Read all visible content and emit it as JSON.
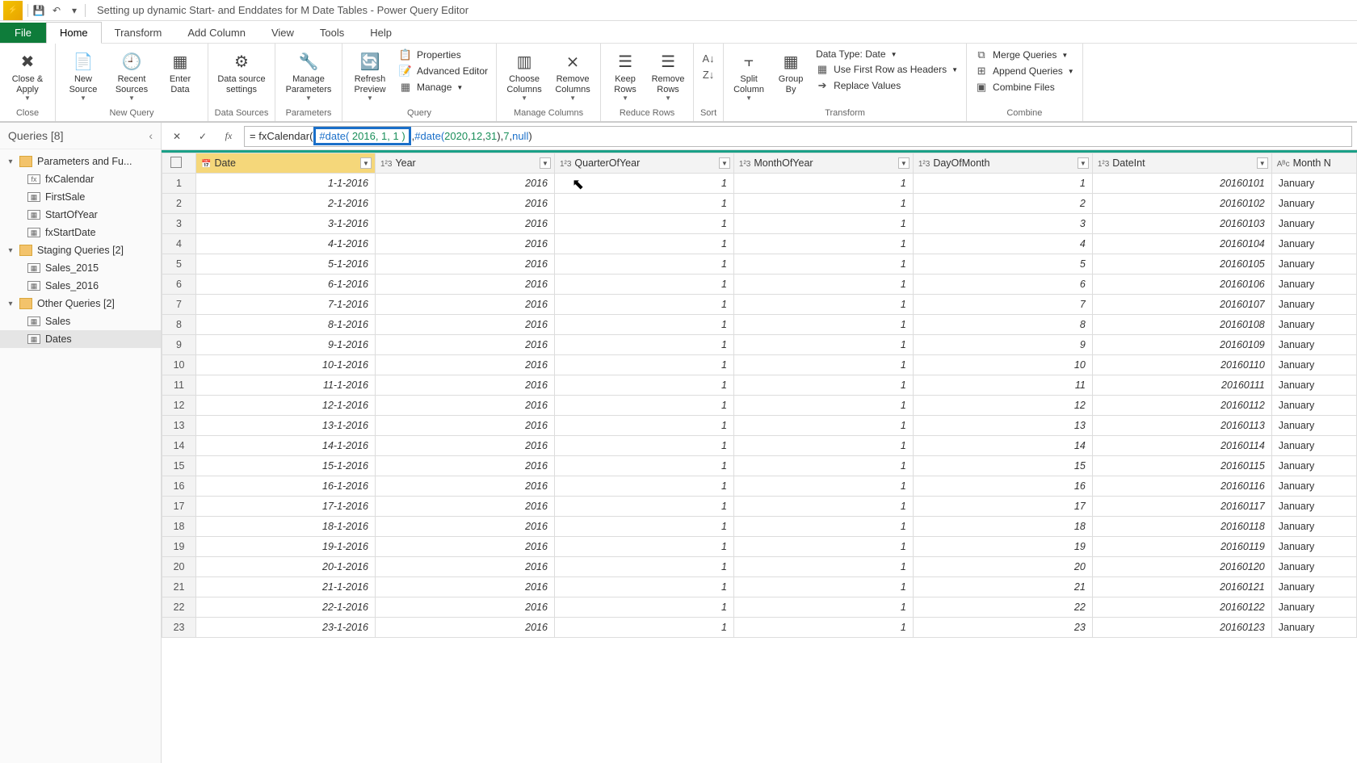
{
  "title": "Setting up dynamic Start- and Enddates for M Date Tables - Power Query Editor",
  "tabs": {
    "file": "File",
    "home": "Home",
    "transform": "Transform",
    "addcol": "Add Column",
    "view": "View",
    "tools": "Tools",
    "help": "Help"
  },
  "ribbon": {
    "close": {
      "close_apply": "Close &\nApply",
      "group": "Close"
    },
    "newquery": {
      "new_source": "New\nSource",
      "recent": "Recent\nSources",
      "enter": "Enter\nData",
      "group": "New Query"
    },
    "datasources": {
      "settings": "Data source\nsettings",
      "group": "Data Sources"
    },
    "parameters": {
      "manage": "Manage\nParameters",
      "group": "Parameters"
    },
    "query": {
      "refresh": "Refresh\nPreview",
      "properties": "Properties",
      "adv": "Advanced Editor",
      "manage": "Manage",
      "group": "Query"
    },
    "managecols": {
      "choose": "Choose\nColumns",
      "remove": "Remove\nColumns",
      "group": "Manage Columns"
    },
    "reducerows": {
      "keep": "Keep\nRows",
      "remove": "Remove\nRows",
      "group": "Reduce Rows"
    },
    "sort": {
      "group": "Sort"
    },
    "transform": {
      "split": "Split\nColumn",
      "groupby": "Group\nBy",
      "datatype": "Data Type: Date",
      "firstrow": "Use First Row as Headers",
      "replace": "Replace Values",
      "group": "Transform"
    },
    "combine": {
      "merge": "Merge Queries",
      "append": "Append Queries",
      "combinefiles": "Combine Files",
      "group": "Combine"
    }
  },
  "queries": {
    "header": "Queries [8]",
    "folder1": "Parameters and Fu...",
    "fxCalendar": "fxCalendar",
    "firstSale": "FirstSale",
    "startOfYear": "StartOfYear",
    "fxStartDate": "fxStartDate",
    "folder2": "Staging Queries [2]",
    "sales2015": "Sales_2015",
    "sales2016": "Sales_2016",
    "folder3": "Other Queries [2]",
    "sales": "Sales",
    "dates": "Dates"
  },
  "formula": {
    "prefix": "= fxCalendar(",
    "hl_kw": "#date(",
    "hl_args": " 2016, 1, 1 )",
    "mid": ", ",
    "kw2": "#date(",
    "args2_a": " 2020",
    "args2_b": ", ",
    "args2_c": "12",
    "args2_d": ", ",
    "args2_e": "31",
    "args2_f": "), ",
    "arg3": "7",
    "sep": ", ",
    "arg4": "null",
    "end": ")"
  },
  "columns": {
    "date": "Date",
    "year": "Year",
    "quarter": "QuarterOfYear",
    "month": "MonthOfYear",
    "day": "DayOfMonth",
    "dateint": "DateInt",
    "monthname": "Month N"
  },
  "rows": [
    {
      "n": 1,
      "date": "1-1-2016",
      "year": 2016,
      "q": 1,
      "m": 1,
      "d": 1,
      "di": 20160101,
      "mn": "January"
    },
    {
      "n": 2,
      "date": "2-1-2016",
      "year": 2016,
      "q": 1,
      "m": 1,
      "d": 2,
      "di": 20160102,
      "mn": "January"
    },
    {
      "n": 3,
      "date": "3-1-2016",
      "year": 2016,
      "q": 1,
      "m": 1,
      "d": 3,
      "di": 20160103,
      "mn": "January"
    },
    {
      "n": 4,
      "date": "4-1-2016",
      "year": 2016,
      "q": 1,
      "m": 1,
      "d": 4,
      "di": 20160104,
      "mn": "January"
    },
    {
      "n": 5,
      "date": "5-1-2016",
      "year": 2016,
      "q": 1,
      "m": 1,
      "d": 5,
      "di": 20160105,
      "mn": "January"
    },
    {
      "n": 6,
      "date": "6-1-2016",
      "year": 2016,
      "q": 1,
      "m": 1,
      "d": 6,
      "di": 20160106,
      "mn": "January"
    },
    {
      "n": 7,
      "date": "7-1-2016",
      "year": 2016,
      "q": 1,
      "m": 1,
      "d": 7,
      "di": 20160107,
      "mn": "January"
    },
    {
      "n": 8,
      "date": "8-1-2016",
      "year": 2016,
      "q": 1,
      "m": 1,
      "d": 8,
      "di": 20160108,
      "mn": "January"
    },
    {
      "n": 9,
      "date": "9-1-2016",
      "year": 2016,
      "q": 1,
      "m": 1,
      "d": 9,
      "di": 20160109,
      "mn": "January"
    },
    {
      "n": 10,
      "date": "10-1-2016",
      "year": 2016,
      "q": 1,
      "m": 1,
      "d": 10,
      "di": 20160110,
      "mn": "January"
    },
    {
      "n": 11,
      "date": "11-1-2016",
      "year": 2016,
      "q": 1,
      "m": 1,
      "d": 11,
      "di": 20160111,
      "mn": "January"
    },
    {
      "n": 12,
      "date": "12-1-2016",
      "year": 2016,
      "q": 1,
      "m": 1,
      "d": 12,
      "di": 20160112,
      "mn": "January"
    },
    {
      "n": 13,
      "date": "13-1-2016",
      "year": 2016,
      "q": 1,
      "m": 1,
      "d": 13,
      "di": 20160113,
      "mn": "January"
    },
    {
      "n": 14,
      "date": "14-1-2016",
      "year": 2016,
      "q": 1,
      "m": 1,
      "d": 14,
      "di": 20160114,
      "mn": "January"
    },
    {
      "n": 15,
      "date": "15-1-2016",
      "year": 2016,
      "q": 1,
      "m": 1,
      "d": 15,
      "di": 20160115,
      "mn": "January"
    },
    {
      "n": 16,
      "date": "16-1-2016",
      "year": 2016,
      "q": 1,
      "m": 1,
      "d": 16,
      "di": 20160116,
      "mn": "January"
    },
    {
      "n": 17,
      "date": "17-1-2016",
      "year": 2016,
      "q": 1,
      "m": 1,
      "d": 17,
      "di": 20160117,
      "mn": "January"
    },
    {
      "n": 18,
      "date": "18-1-2016",
      "year": 2016,
      "q": 1,
      "m": 1,
      "d": 18,
      "di": 20160118,
      "mn": "January"
    },
    {
      "n": 19,
      "date": "19-1-2016",
      "year": 2016,
      "q": 1,
      "m": 1,
      "d": 19,
      "di": 20160119,
      "mn": "January"
    },
    {
      "n": 20,
      "date": "20-1-2016",
      "year": 2016,
      "q": 1,
      "m": 1,
      "d": 20,
      "di": 20160120,
      "mn": "January"
    },
    {
      "n": 21,
      "date": "21-1-2016",
      "year": 2016,
      "q": 1,
      "m": 1,
      "d": 21,
      "di": 20160121,
      "mn": "January"
    },
    {
      "n": 22,
      "date": "22-1-2016",
      "year": 2016,
      "q": 1,
      "m": 1,
      "d": 22,
      "di": 20160122,
      "mn": "January"
    },
    {
      "n": 23,
      "date": "23-1-2016",
      "year": 2016,
      "q": 1,
      "m": 1,
      "d": 23,
      "di": 20160123,
      "mn": "January"
    }
  ]
}
